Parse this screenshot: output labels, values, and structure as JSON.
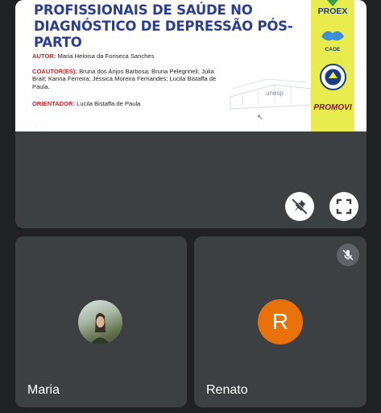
{
  "slide": {
    "title": "PROFISSIONAIS DE SAÚDE NO DIAGNÓSTICO DE DEPRESSÃO PÓS-PARTO",
    "autor_label": "AUTOR:",
    "autor": "Maria Heloisa da Fonseca Sanches",
    "coautores_label": "COAUTOR(ES):",
    "coautores": "Bruna dos Anjos Barbosa; Bruna Pelegrineli; Júlia Brait; Karina Ferreira; Jéssica Moreira Fernandes; Lucila Bistaffa de Paula.",
    "orientador_label": "ORIENTADOR:",
    "orientador": "Lucila Bistaffa de Paula",
    "unesp": "unesp",
    "logos": {
      "proex": "PROEX",
      "caoe": "CAOE",
      "promovi": "PROMOVI"
    }
  },
  "controls": {
    "pin_icon": "pin-off-icon",
    "fullscreen_icon": "fullscreen-icon"
  },
  "participants": [
    {
      "name": "Maria",
      "avatar": "photo"
    },
    {
      "name": "Renato",
      "avatar_letter": "R",
      "muted": true
    }
  ],
  "colors": {
    "background": "#202124",
    "tile": "#3c4043",
    "title_blue": "#2b3f8a",
    "label_red": "#b8282c",
    "sidebar_yellow": "#e9ec4e",
    "renato_avatar": "#e8710a"
  }
}
